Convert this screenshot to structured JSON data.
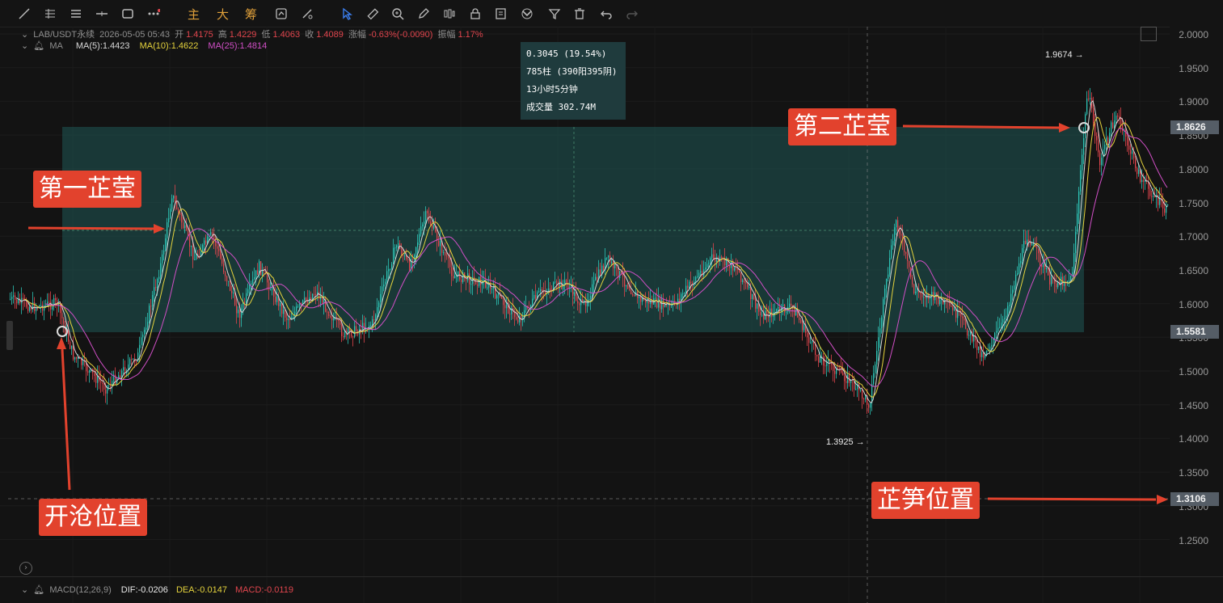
{
  "toolbar": {
    "text_buttons": [
      "主",
      "大",
      "筹"
    ]
  },
  "legend": {
    "symbol": "LAB/USDT永续",
    "datetime": "2026-05-05 05:43",
    "open_label": "开",
    "open": "1.4175",
    "high_label": "高",
    "high": "1.4229",
    "low_label": "低",
    "low": "1.4063",
    "close_label": "收",
    "close": "1.4089",
    "change_label": "涨幅",
    "change": "-0.63%(-0.0090)",
    "amplitude_label": "振幅",
    "amplitude": "1.17%",
    "ma_name": "MA",
    "ma5": "MA(5):1.4423",
    "ma10": "MA(10):1.4622",
    "ma25": "MA(25):1.4814"
  },
  "macd": {
    "name": "MACD(12,26,9)",
    "dif": "DIF:-0.0206",
    "dea": "DEA:-0.0147",
    "macd": "MACD:-0.0119"
  },
  "price_axis": [
    "2.0000",
    "1.9500",
    "1.9000",
    "1.8500",
    "1.8000",
    "1.7500",
    "1.7000",
    "1.6500",
    "1.6000",
    "1.5500",
    "1.5000",
    "1.4500",
    "1.4000",
    "1.3500",
    "1.3000",
    "1.2500"
  ],
  "price_tags": {
    "upper": "1.8626",
    "lower": "1.5581",
    "current": "1.3106"
  },
  "measure_tooltip": {
    "line1": "0.3045 (19.54%)",
    "line2": "785柱 (390阳395阴)",
    "line3": "13小时5分钟",
    "line4": "成交量 302.74M"
  },
  "extremes": {
    "high": "1.9674",
    "low": "1.3925"
  },
  "annotations": {
    "first": "第一芷莹",
    "second": "第二芷莹",
    "open_position": "开沧位置",
    "bamboo_position": "芷笋位置"
  },
  "colors": {
    "up": "#2ec4b6",
    "down": "#e0454d",
    "box": "#1e5a58",
    "annot": "#e2422d",
    "ma5": "#d8d8d8",
    "ma10": "#e5d33d",
    "ma25": "#d14fc6"
  }
}
